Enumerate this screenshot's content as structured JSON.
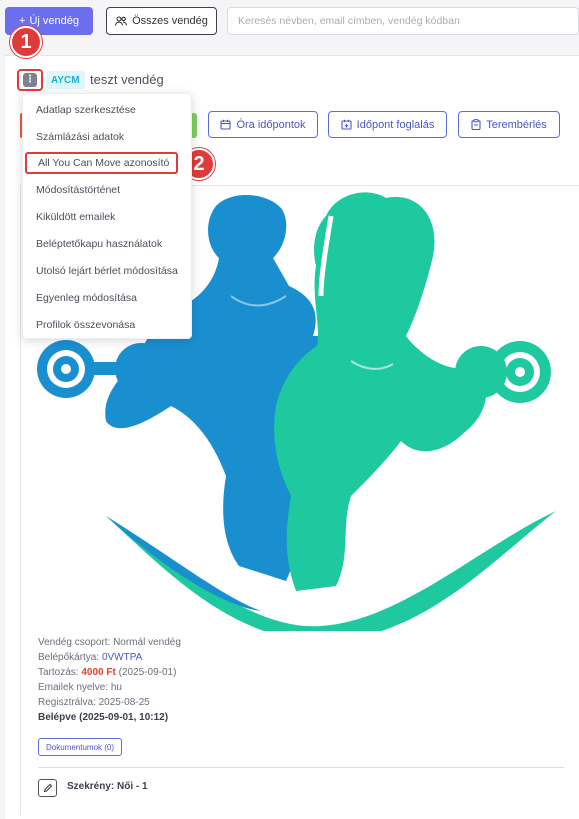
{
  "topbar": {
    "new_guest_label": "Új vendég",
    "new_guest_icon": "plus-icon",
    "all_guests_label": "Összes vendég",
    "all_guests_icon": "users-icon",
    "search_placeholder": "Keresés névben, email címben, vendég kódban"
  },
  "annotations": {
    "step1": "1",
    "step2": "2"
  },
  "guest": {
    "tag": "AYCM",
    "name": "teszt vendég",
    "menu_icon": "kebab-menu-icon"
  },
  "actions": [
    {
      "label": "Óra időpontok",
      "icon": "calendar-icon"
    },
    {
      "label": "Időpont foglalás",
      "icon": "calendar-plus-icon"
    },
    {
      "label": "Terembérlés",
      "icon": "clipboard-icon"
    }
  ],
  "menu": {
    "items": [
      "Adatlap szerkesztése",
      "Számlázási adatok",
      "All You Can Move azonosító",
      "Módosítástörténet",
      "Kiküldött emailek",
      "Beléptetőkapu használatok",
      "Utolsó lejárt bérlet módosítása",
      "Egyenleg módosítása",
      "Profilok összevonása"
    ],
    "highlighted_index": 2
  },
  "colors": {
    "accent": "#5b6ee0",
    "male_figure": "#1a8fd0",
    "female_figure": "#1ec9a0",
    "annotation": "#e03a3a"
  },
  "details": {
    "group_label": "Vendég csoport:",
    "group_value": "Normál vendég",
    "card_label": "Belépőkártya:",
    "card_value": "0VWTPA",
    "debt_label": "Tartozás:",
    "debt_value": "4000 Ft",
    "debt_date": "(2025-09-01)",
    "email_lang_label": "Emailek nyelve:",
    "email_lang_value": "hu",
    "registered_label": "Regisztrálva:",
    "registered_value": "2025-08-25",
    "entered": "Belépve (2025-09-01, 10:12)"
  },
  "documents_button": "Dokumentumok (0)",
  "locker": {
    "label": "Szekrény: Női - 1",
    "icon": "edit-icon"
  }
}
